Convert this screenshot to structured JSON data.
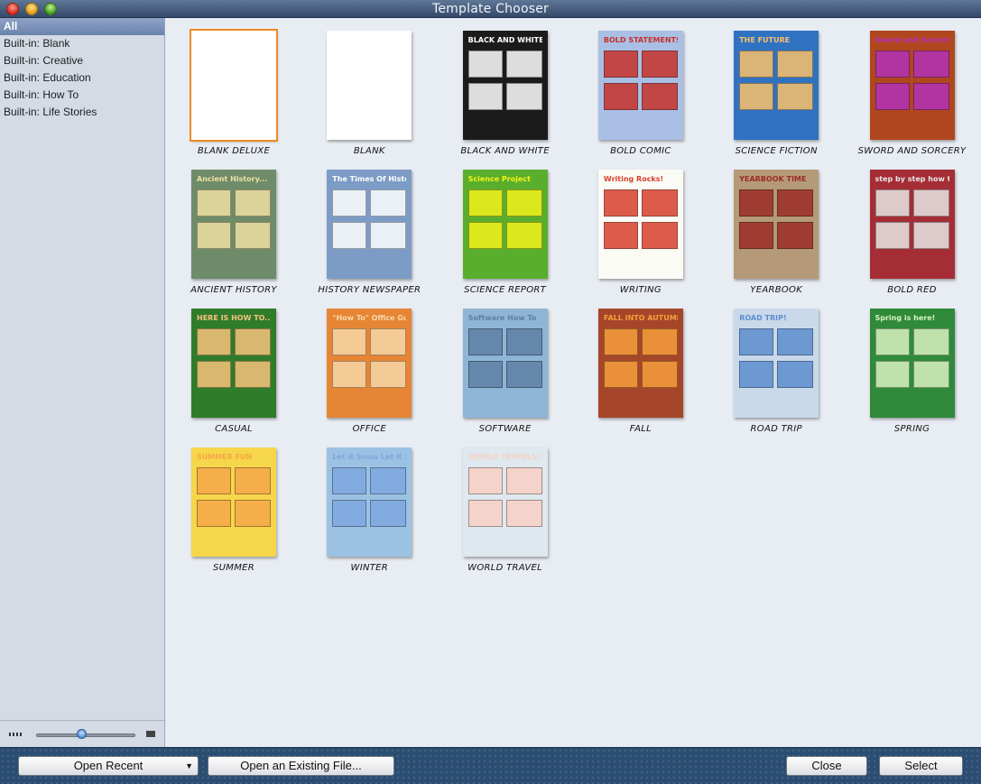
{
  "window": {
    "title": "Template Chooser"
  },
  "sidebar": {
    "items": [
      {
        "label": "All",
        "selected": true
      },
      {
        "label": "Built-in: Blank"
      },
      {
        "label": "Built-in: Creative"
      },
      {
        "label": "Built-in: Education"
      },
      {
        "label": "Built-in: How To"
      },
      {
        "label": "Built-in: Life Stories"
      }
    ],
    "thumbnail_size": 0.45
  },
  "templates": [
    {
      "name": "BLANK DELUXE",
      "heading": "",
      "bg": "#ffffff",
      "accent": "#f08a24",
      "selected": true
    },
    {
      "name": "BLANK",
      "heading": "",
      "bg": "#ffffff",
      "accent": "#cccccc"
    },
    {
      "name": "BLACK AND WHITE",
      "heading": "BLACK AND WHITE",
      "bg": "#1b1b1b",
      "accent": "#ffffff"
    },
    {
      "name": "BOLD COMIC",
      "heading": "BOLD STATEMENTS",
      "bg": "#a9bfe4",
      "accent": "#c6312a"
    },
    {
      "name": "SCIENCE FICTION",
      "heading": "THE FUTURE",
      "bg": "#2f72c2",
      "accent": "#f9c06b"
    },
    {
      "name": "SWORD AND SORCERY",
      "heading": "Sword and Sorcery",
      "bg": "#b0461e",
      "accent": "#b231b8"
    },
    {
      "name": "ANCIENT HISTORY",
      "heading": "Ancient History...",
      "bg": "#6f8c6a",
      "accent": "#efe0a4"
    },
    {
      "name": "HISTORY NEWSPAPER",
      "heading": "The Times Of History",
      "bg": "#7c9cc6",
      "accent": "#ffffff"
    },
    {
      "name": "SCIENCE REPORT",
      "heading": "Science Project",
      "bg": "#5aae2d",
      "accent": "#f4f21b"
    },
    {
      "name": "WRITING",
      "heading": "Writing Rocks!",
      "bg": "#fbfbf6",
      "accent": "#d7402d"
    },
    {
      "name": "YEARBOOK",
      "heading": "YEARBOOK TIME",
      "bg": "#b49a78",
      "accent": "#9c2c26"
    },
    {
      "name": "BOLD RED",
      "heading": "step by step how to...",
      "bg": "#a52d35",
      "accent": "#e7e7e7"
    },
    {
      "name": "CASUAL",
      "heading": "HERE IS HOW TO...",
      "bg": "#2f7c2b",
      "accent": "#f6c27c"
    },
    {
      "name": "OFFICE",
      "heading": "\"How To\" Office Guide",
      "bg": "#e68533",
      "accent": "#f7d8a8"
    },
    {
      "name": "SOFTWARE",
      "heading": "Software How To",
      "bg": "#8fb5d4",
      "accent": "#5e7fa5"
    },
    {
      "name": "FALL",
      "heading": "FALL INTO AUTUMN...",
      "bg": "#a5462a",
      "accent": "#f59d3b"
    },
    {
      "name": "ROAD TRIP",
      "heading": "ROAD TRIP!",
      "bg": "#c9d9ea",
      "accent": "#5e8ed0"
    },
    {
      "name": "SPRING",
      "heading": "Spring is here!",
      "bg": "#2f8a3a",
      "accent": "#d9f2c2"
    },
    {
      "name": "SUMMER",
      "heading": "SUMMER FUN",
      "bg": "#f6d64a",
      "accent": "#f6a84a"
    },
    {
      "name": "WINTER",
      "heading": "Let it Snow Let it Snow!",
      "bg": "#9cc2e3",
      "accent": "#7ea7e0"
    },
    {
      "name": "WORLD TRAVEL",
      "heading": "WORLD TRAVELS!",
      "bg": "#dfe7ef",
      "accent": "#f8d1c4"
    }
  ],
  "footer": {
    "open_recent": "Open Recent",
    "open_existing": "Open an Existing File...",
    "close": "Close",
    "select": "Select"
  },
  "colors": {
    "titlebar": "#34496a",
    "sidebar": "#d4dbe5",
    "selection": "#6a82ad",
    "bottombar": "#2c4d72"
  }
}
